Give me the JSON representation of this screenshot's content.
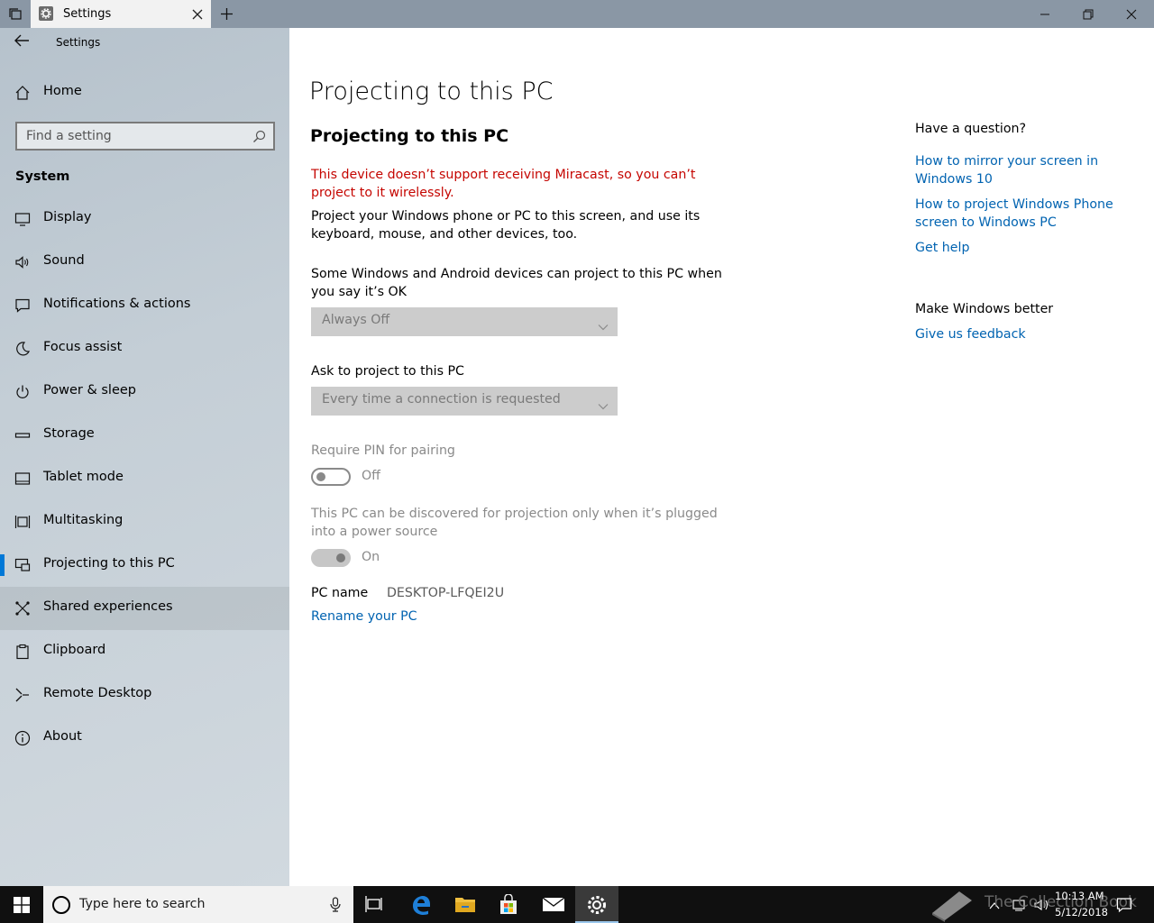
{
  "titlebar": {
    "tab_title": "Settings"
  },
  "sidebar": {
    "app_title": "Settings",
    "home_label": "Home",
    "search_placeholder": "Find a setting",
    "section_header": "System",
    "items": [
      {
        "label": "Display",
        "icon": "display-icon"
      },
      {
        "label": "Sound",
        "icon": "sound-icon"
      },
      {
        "label": "Notifications & actions",
        "icon": "notifications-icon"
      },
      {
        "label": "Focus assist",
        "icon": "moon-icon"
      },
      {
        "label": "Power & sleep",
        "icon": "power-icon"
      },
      {
        "label": "Storage",
        "icon": "storage-icon"
      },
      {
        "label": "Tablet mode",
        "icon": "tablet-icon"
      },
      {
        "label": "Multitasking",
        "icon": "multitasking-icon"
      },
      {
        "label": "Projecting to this PC",
        "icon": "projecting-icon",
        "selected": true
      },
      {
        "label": "Shared experiences",
        "icon": "shared-experiences-icon",
        "hover": true
      },
      {
        "label": "Clipboard",
        "icon": "clipboard-icon"
      },
      {
        "label": "Remote Desktop",
        "icon": "remote-desktop-icon"
      },
      {
        "label": "About",
        "icon": "info-icon"
      }
    ]
  },
  "main": {
    "page_title": "Projecting to this PC",
    "section_title": "Projecting to this PC",
    "warning": "This device doesn’t support receiving Miracast, so you can’t project to it wirelessly.",
    "description": "Project your Windows phone or PC to this screen, and use its keyboard, mouse, and other devices, too.",
    "availability_label": "Some Windows and Android devices can project to this PC when you say it’s OK",
    "availability_value": "Always Off",
    "ask_label": "Ask to project to this PC",
    "ask_value": "Every time a connection is requested",
    "pin_label": "Require PIN for pairing",
    "pin_state": "Off",
    "power_label": "This PC can be discovered for projection only when it’s plugged into a power source",
    "power_state": "On",
    "pc_name_label": "PC name",
    "pc_name_value": "DESKTOP-LFQEI2U",
    "rename_link": "Rename your PC"
  },
  "related": {
    "question_heading": "Have a question?",
    "links": [
      "How to mirror your screen in Windows 10",
      "How to project Windows Phone screen to Windows PC",
      "Get help"
    ],
    "better_heading": "Make Windows better",
    "feedback_link": "Give us feedback"
  },
  "taskbar": {
    "search_placeholder": "Type here to search",
    "watermark": "The Collection Book",
    "time": "10:13 AM",
    "date": "5/12/2018"
  },
  "colors": {
    "accent": "#0078d7",
    "link": "#0063b1",
    "warning": "#c50500"
  }
}
